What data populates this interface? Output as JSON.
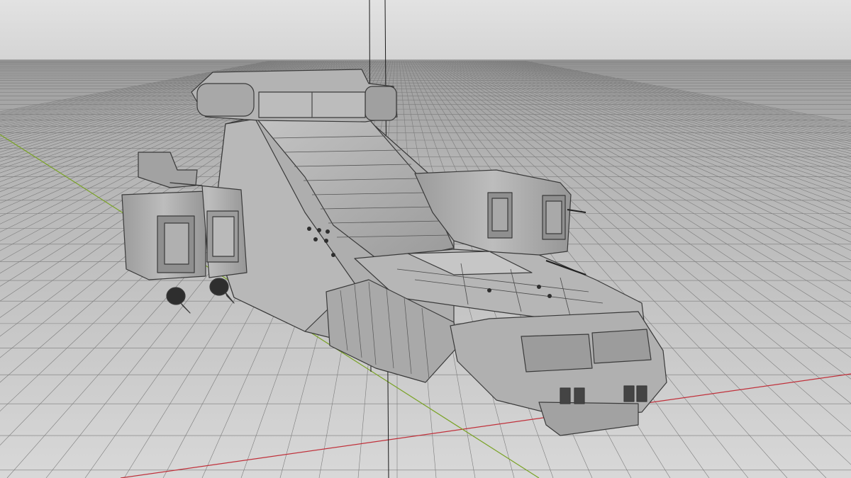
{
  "viewport": {
    "view": "perspective",
    "display_mode": "wireframe-shaded",
    "grid_visible": true,
    "axes_visible": true,
    "colors": {
      "background": "#dcdcdc",
      "horizon_band": "#999999",
      "grid_floor": "#c8c8c8",
      "grid_line": "#7c7c7c",
      "x_axis": "#c0303a",
      "y_axis": "#7aa326",
      "z_axis": "#1a1a1a",
      "hull_light": "#b9b9b9",
      "hull_mid": "#a4a4a4",
      "hull_dark": "#8d8d8d",
      "hull_edge": "#3a3a3a"
    }
  },
  "model": {
    "subject": "spaceship-mesh"
  }
}
